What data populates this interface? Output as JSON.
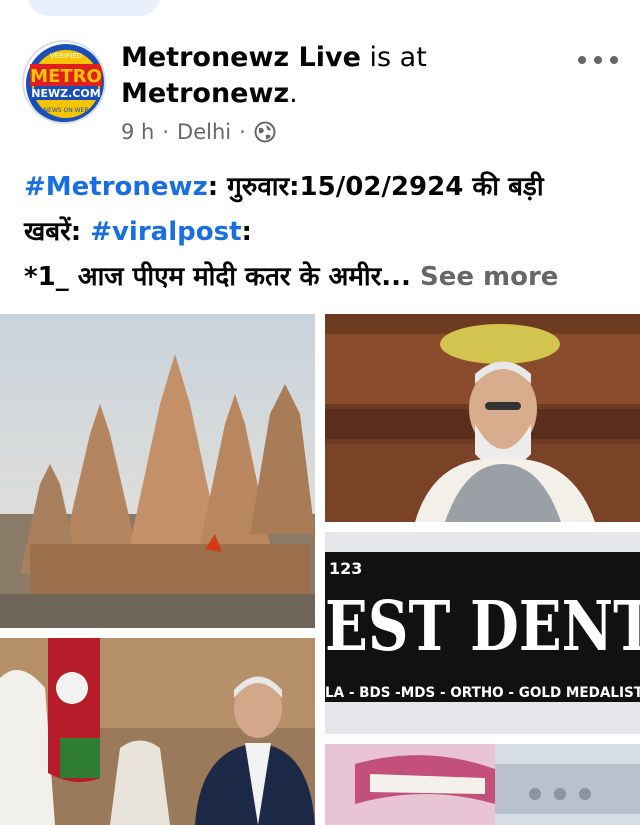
{
  "post": {
    "author_name": "Metronewz Live",
    "connector": " is at",
    "location_name": "Metronewz",
    "location_suffix": ".",
    "time": "9 h",
    "separator": "·",
    "place": "Delhi",
    "separator2": "·",
    "audience_icon": "globe-icon",
    "more_icon": "more-options-icon",
    "line1_hashtag": "#Metronewz",
    "line1_text": ": गुरुवार:15/02/2924 की बड़ी",
    "line2_text": "खबरें: ",
    "line2_hashtag": "#viralpost",
    "line2_suffix": ":",
    "line3_text": "*1_ आज पीएम मोदी कतर के अमीर...",
    "see_more": " See more"
  },
  "avatar": {
    "logo_text_main": "METRO",
    "logo_text_sub": "NEWZ.COM",
    "logo_text_top": "VERIFIED",
    "logo_text_bottom": "NEWS ON WEB"
  },
  "photos": {
    "photo3_number": "123",
    "photo3_sign": "EST DENT",
    "photo3_sub": "LA - BDS -MDS - ORTHO - GOLD MEDALIST"
  },
  "colors": {
    "hashtag": "#1a6fe0",
    "secondary_text": "#65676b",
    "logo_red": "#e02020",
    "logo_blue": "#1b4fb8",
    "logo_yellow": "#f6c400"
  }
}
